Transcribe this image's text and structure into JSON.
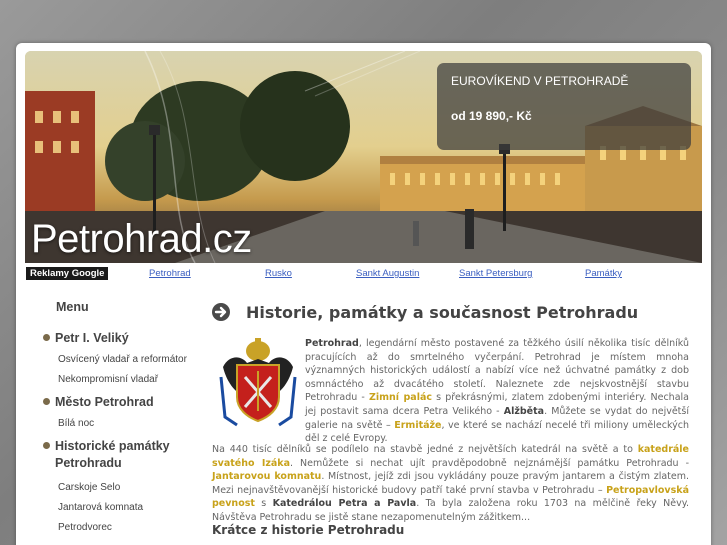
{
  "hero": {
    "site_name": "Petrohrad.cz",
    "promo_title": "EUROVÍKEND V PETROHRADĚ",
    "promo_price": "od 19 890,- Kč"
  },
  "nav": {
    "ads_label": "Reklamy Google",
    "links": [
      "Petrohrad",
      "Rusko",
      "Sankt Augustin",
      "Sankt Petersburg",
      "Památky"
    ]
  },
  "sidebar": {
    "heading": "Menu",
    "sections": [
      {
        "label": "Petr I. Veliký",
        "items": [
          "Osvícený vladař a reformátor",
          "Nekompromisní vladař"
        ]
      },
      {
        "label": "Město Petrohrad",
        "items": [
          "Bílá noc"
        ]
      },
      {
        "label_line1": "Historické památky",
        "label_line2": "Petrohradu",
        "items": [
          "Carskoje Selo",
          "Jantarová komnata",
          "Petrodvorec"
        ]
      }
    ]
  },
  "main": {
    "title": "Historie, památky a současnost Petrohradu",
    "p1": {
      "b1": "Petrohrad",
      "t1": ", legendární město postavené za těžkého úsilí několika tisíc dělníků pracujících až do smrtelného vyčerpání. Petrohrad je místem mnoha významných historických událostí a nabízí více než úchvatné památky z dob osmnáctého až dvacátého století. Naleznete zde nejskvostnější stavbu Petrohradu - ",
      "a1": "Zimní palác",
      "t2": " s překrásnými, zlatem zdobenými interiéry. Nechala jej postavit sama dcera Petra Velikého - ",
      "b2": "Alžběta",
      "t3": ". Můžete se vydat do největší galerie na světě – ",
      "a2": "Ermitáže",
      "t4": ", ve které se nachází necelé tři miliony uměleckých děl z celé Evropy."
    },
    "p2": {
      "t1": "Na 440 tisíc dělníků se podílelo na stavbě jedné z největších katedrál na světě a to ",
      "a1": "katedrále svatého Izáka",
      "t2": ". Nemůžete si nechat ujít pravděpodobně nejznámější památku Petrohradu - ",
      "a2": "Jantarovou komnatu",
      "t3": ". Místnost, jejíž zdi jsou vykládány pouze pravým jantarem a čistým zlatem. Mezi nejnavštěvovanější historické budovy patří také první stavba v Petrohradu – ",
      "a3": "Petropavlovská pevnost",
      "t4": " s ",
      "b1": "Katedrálou Petra a Pavla",
      "t5": ". Ta byla založena roku 1703 na mělčině řeky Něvy. Návštěva Petrohradu se jistě stane nezapomenutelným zážitkem..."
    },
    "subtitle": "Krátce z historie Petrohradu"
  }
}
